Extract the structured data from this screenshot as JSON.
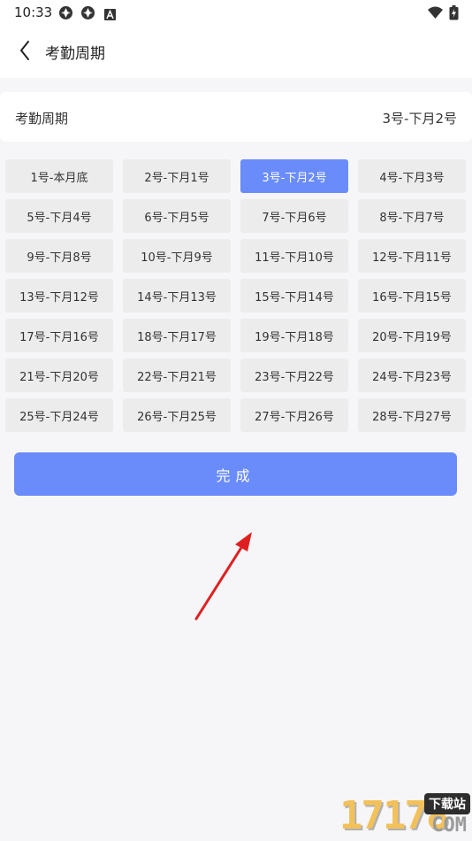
{
  "status_bar": {
    "time": "10:33",
    "icons": [
      "app-notification-icon",
      "app-notification-icon",
      "a-badge-icon",
      "wifi-icon",
      "battery-icon"
    ]
  },
  "header": {
    "back_icon": "chevron-left-icon",
    "title": "考勤周期"
  },
  "cycle_card": {
    "label": "考勤周期",
    "value": "3号-下月2号"
  },
  "options": [
    {
      "label": "1号-本月底",
      "selected": false
    },
    {
      "label": "2号-下月1号",
      "selected": false
    },
    {
      "label": "3号-下月2号",
      "selected": true
    },
    {
      "label": "4号-下月3号",
      "selected": false
    },
    {
      "label": "5号-下月4号",
      "selected": false
    },
    {
      "label": "6号-下月5号",
      "selected": false
    },
    {
      "label": "7号-下月6号",
      "selected": false
    },
    {
      "label": "8号-下月7号",
      "selected": false
    },
    {
      "label": "9号-下月8号",
      "selected": false
    },
    {
      "label": "10号-下月9号",
      "selected": false
    },
    {
      "label": "11号-下月10号",
      "selected": false
    },
    {
      "label": "12号-下月11号",
      "selected": false
    },
    {
      "label": "13号-下月12号",
      "selected": false
    },
    {
      "label": "14号-下月13号",
      "selected": false
    },
    {
      "label": "15号-下月14号",
      "selected": false
    },
    {
      "label": "16号-下月15号",
      "selected": false
    },
    {
      "label": "17号-下月16号",
      "selected": false
    },
    {
      "label": "18号-下月17号",
      "selected": false
    },
    {
      "label": "19号-下月18号",
      "selected": false
    },
    {
      "label": "20号-下月19号",
      "selected": false
    },
    {
      "label": "21号-下月20号",
      "selected": false
    },
    {
      "label": "22号-下月21号",
      "selected": false
    },
    {
      "label": "23号-下月22号",
      "selected": false
    },
    {
      "label": "24号-下月23号",
      "selected": false
    },
    {
      "label": "25号-下月24号",
      "selected": false
    },
    {
      "label": "26号-下月25号",
      "selected": false
    },
    {
      "label": "27号-下月26号",
      "selected": false
    },
    {
      "label": "28号-下月27号",
      "selected": false
    }
  ],
  "done_button": {
    "label": "完成"
  },
  "annotation": {
    "icon": "red-arrow-icon",
    "color": "#e02020"
  },
  "watermark": {
    "number": "17178",
    "tag": "下载站",
    "suffix": "COM"
  },
  "colors": {
    "accent": "#6a8cfa",
    "option_bg": "#ececec",
    "page_bg": "#f6f6f8"
  }
}
